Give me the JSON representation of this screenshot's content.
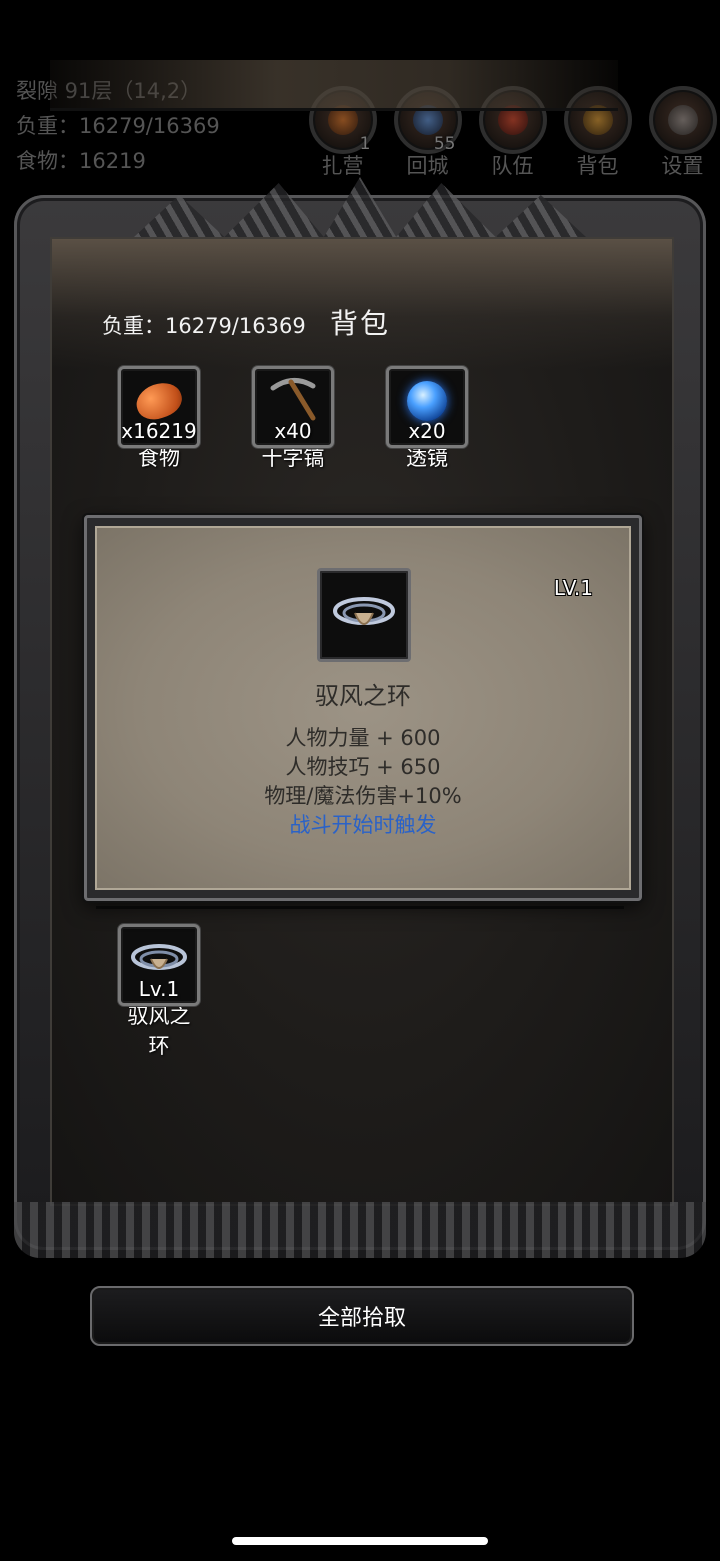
{
  "hud": {
    "location": "裂隙 91层（14,2）",
    "weight": "负重：16279/16369",
    "food": "食物：16219",
    "buttons": [
      {
        "label": "扎营",
        "badge": "1",
        "icon": "campfire-icon",
        "color": "#6a3a18"
      },
      {
        "label": "回城",
        "badge": "55",
        "icon": "portal-icon",
        "color": "#1f3c66"
      },
      {
        "label": "队伍",
        "badge": "",
        "icon": "banner-icon",
        "color": "#6a1c14"
      },
      {
        "label": "背包",
        "badge": "",
        "icon": "backpack-icon",
        "color": "#6a4a18"
      },
      {
        "label": "设置",
        "badge": "",
        "icon": "gear-icon",
        "color": "#4a4a4a"
      }
    ]
  },
  "bag": {
    "weight": "负重：16279/16369",
    "title": "背包",
    "items": [
      {
        "name": "食物",
        "count": "x16219",
        "icon": "food-icon"
      },
      {
        "name": "十字镐",
        "count": "x40",
        "icon": "pickaxe-icon"
      },
      {
        "name": "透镜",
        "count": "x20",
        "icon": "lens-icon"
      }
    ]
  },
  "detail": {
    "level": "LV.1",
    "name": "驭风之环",
    "stats": [
      "人物力量 + 600",
      "人物技巧 + 650",
      "物理/魔法伤害+10%"
    ],
    "trigger": "战斗开始时触发",
    "icon": "wind-ring-icon"
  },
  "equipment": [
    {
      "name": "驭风之环",
      "level": "Lv.1",
      "icon": "wind-ring-icon"
    }
  ],
  "pickup_all": "全部拾取",
  "colors": {
    "trigger_text": "#2a62c8",
    "panel_parchment": "#9c9385"
  }
}
